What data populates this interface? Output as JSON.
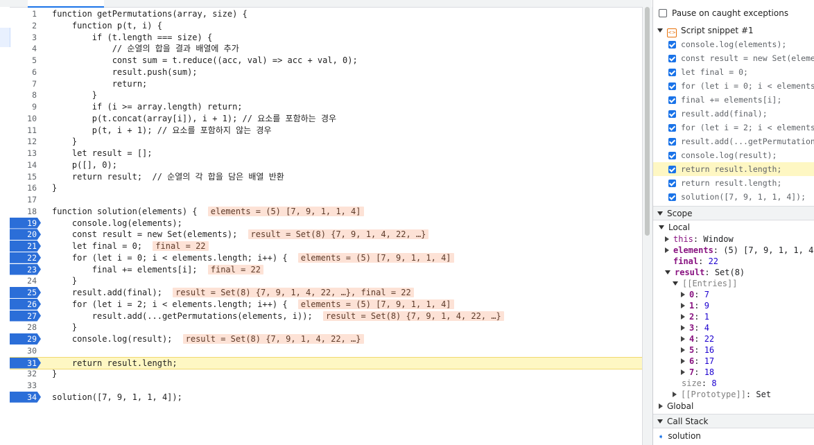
{
  "editor": {
    "lines": [
      {
        "n": "1",
        "text": "function getPermutations(array, size) {"
      },
      {
        "n": "2",
        "text": "    function p(t, i) {"
      },
      {
        "n": "3",
        "text": "        if (t.length === size) {"
      },
      {
        "n": "4",
        "text": "            // 순열의 합을 결과 배열에 추가"
      },
      {
        "n": "5",
        "text": "            const sum = t.reduce((acc, val) => acc + val, 0);"
      },
      {
        "n": "6",
        "text": "            result.push(sum);"
      },
      {
        "n": "7",
        "text": "            return;"
      },
      {
        "n": "8",
        "text": "        }"
      },
      {
        "n": "9",
        "text": "        if (i >= array.length) return;"
      },
      {
        "n": "10",
        "text": "        p(t.concat(array[i]), i + 1); // 요소를 포함하는 경우"
      },
      {
        "n": "11",
        "text": "        p(t, i + 1); // 요소를 포함하지 않는 경우"
      },
      {
        "n": "12",
        "text": "    }"
      },
      {
        "n": "13",
        "text": "    let result = [];"
      },
      {
        "n": "14",
        "text": "    p([], 0);"
      },
      {
        "n": "15",
        "text": "    return result;  // 순열의 각 합을 담은 배열 반환"
      },
      {
        "n": "16",
        "text": "}"
      },
      {
        "n": "17",
        "text": ""
      },
      {
        "n": "18",
        "text": "function solution(elements) { ",
        "inline": "elements = (5) [7, 9, 1, 1, 4]"
      },
      {
        "n": "19",
        "text": "    console.log(elements);"
      },
      {
        "n": "20",
        "text": "    const result = new Set(elements); ",
        "inline": "result = Set(8) {7, 9, 1, 4, 22, …}"
      },
      {
        "n": "21",
        "text": "    let final = 0; ",
        "inline": "final = 22"
      },
      {
        "n": "22",
        "text": "    for (let i = 0; i < elements.length; i++) { ",
        "inline": "elements = (5) [7, 9, 1, 1, 4]"
      },
      {
        "n": "23",
        "text": "        final += elements[i]; ",
        "inline": "final = 22"
      },
      {
        "n": "24",
        "text": "    }"
      },
      {
        "n": "25",
        "text": "    result.add(final); ",
        "inline": "result = Set(8) {7, 9, 1, 4, 22, …}, final = 22"
      },
      {
        "n": "26",
        "text": "    for (let i = 2; i < elements.length; i++) { ",
        "inline": "elements = (5) [7, 9, 1, 1, 4]"
      },
      {
        "n": "27",
        "text": "        result.add(...getPermutations(elements, i)); ",
        "inline": "result = Set(8) {7, 9, 1, 4, 22, …}"
      },
      {
        "n": "28",
        "text": "    }"
      },
      {
        "n": "29",
        "text": "    console.log(result); ",
        "inline": "result = Set(8) {7, 9, 1, 4, 22, …}"
      },
      {
        "n": "30",
        "text": ""
      },
      {
        "n": "31",
        "text": "    return result.length;"
      },
      {
        "n": "32",
        "text": "}"
      },
      {
        "n": "33",
        "text": ""
      },
      {
        "n": "34",
        "text": "solution([7, 9, 1, 1, 4]);"
      }
    ]
  },
  "panel": {
    "pause_caught": "Pause on caught exceptions",
    "breakpoints_file": "Script snippet #1",
    "breakpoints": [
      "console.log(elements);",
      "const result = new Set(elements)",
      "let final = 0;",
      "for (let i = 0; i < elements.leng",
      "final += elements[i];",
      "result.add(final);",
      "for (let i = 2; i < elements.leng",
      "result.add(...getPermutations(ele",
      "console.log(result);",
      "return result.length;",
      "return result.length;",
      "solution([7, 9, 1, 1, 4]);"
    ],
    "scope_title": "Scope",
    "local_label": "Local",
    "this_name": "this",
    "this_val": "Window",
    "elements_name": "elements",
    "elements_val": "(5) [7, 9, 1, 1, 4]",
    "final_name": "final",
    "final_val": "22",
    "result_name": "result",
    "result_val": "Set(8)",
    "entries_label": "[[Entries]]",
    "entries": [
      {
        "k": "0",
        "v": "7"
      },
      {
        "k": "1",
        "v": "9"
      },
      {
        "k": "2",
        "v": "1"
      },
      {
        "k": "3",
        "v": "4"
      },
      {
        "k": "4",
        "v": "22"
      },
      {
        "k": "5",
        "v": "16"
      },
      {
        "k": "6",
        "v": "17"
      },
      {
        "k": "7",
        "v": "18"
      }
    ],
    "size_label": "size",
    "size_val": "8",
    "proto_label": "[[Prototype]]",
    "proto_val": "Set",
    "global_label": "Global",
    "callstack_title": "Call Stack",
    "callstack_top": "solution"
  }
}
